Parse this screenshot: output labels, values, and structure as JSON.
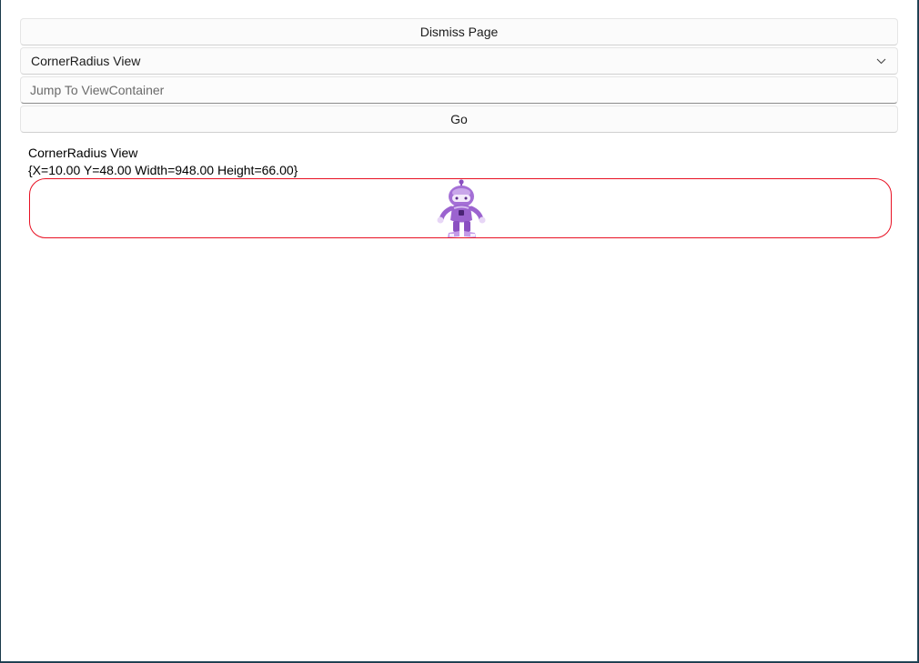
{
  "toolbar": {
    "dismiss_label": "Dismiss Page",
    "picker_selected": "CornerRadius View",
    "jump_placeholder": "Jump To ViewContainer",
    "go_label": "Go"
  },
  "view": {
    "title": "CornerRadius View",
    "bounds": "{X=10.00 Y=48.00 Width=948.00 Height=66.00}",
    "border_color": "#e81123",
    "image": "dotnet-bot-image"
  }
}
